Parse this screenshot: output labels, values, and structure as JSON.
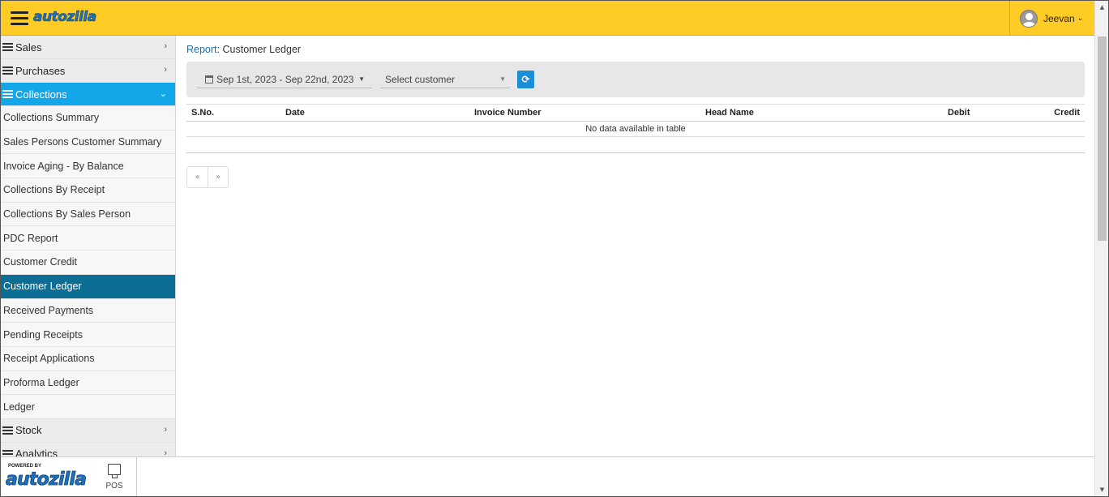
{
  "header": {
    "logo_text": "autozilla",
    "user_name": "Jeevan"
  },
  "sidebar": {
    "groups_top": [
      {
        "label": "Sales"
      },
      {
        "label": "Purchases"
      }
    ],
    "active_group": {
      "label": "Collections"
    },
    "sub_items": [
      {
        "label": "Collections Summary"
      },
      {
        "label": "Sales Persons Customer Summary"
      },
      {
        "label": "Invoice Aging - By Balance"
      },
      {
        "label": "Collections By Receipt"
      },
      {
        "label": "Collections By Sales Person"
      },
      {
        "label": "PDC Report"
      },
      {
        "label": "Customer Credit"
      },
      {
        "label": "Customer Ledger"
      },
      {
        "label": "Received Payments"
      },
      {
        "label": "Pending Receipts"
      },
      {
        "label": "Receipt Applications"
      },
      {
        "label": "Proforma Ledger"
      },
      {
        "label": "Ledger"
      }
    ],
    "groups_bottom": [
      {
        "label": "Stock"
      },
      {
        "label": "Analytics"
      }
    ]
  },
  "breadcrumb": {
    "link": "Report",
    "separator": ":",
    "current": " Customer Ledger"
  },
  "filters": {
    "date_range": "Sep 1st, 2023 - Sep 22nd, 2023",
    "customer_select": "Select customer"
  },
  "table": {
    "headers": {
      "sno": "S.No.",
      "date": "Date",
      "invoice": "Invoice Number",
      "head": "Head Name",
      "debit": "Debit",
      "credit": "Credit"
    },
    "empty_message": "No data available in table"
  },
  "pager": {
    "prev": "«",
    "next": "»"
  },
  "footer": {
    "powered_by": "POWERED BY",
    "logo_text": "autozilla",
    "pos_label": "POS"
  },
  "colors": {
    "header_bg": "#ffcb25",
    "active_group_bg": "#13a6e8",
    "selected_item_bg": "#0d6e95",
    "link": "#1d6fae",
    "refresh_button": "#1a8ed6"
  }
}
